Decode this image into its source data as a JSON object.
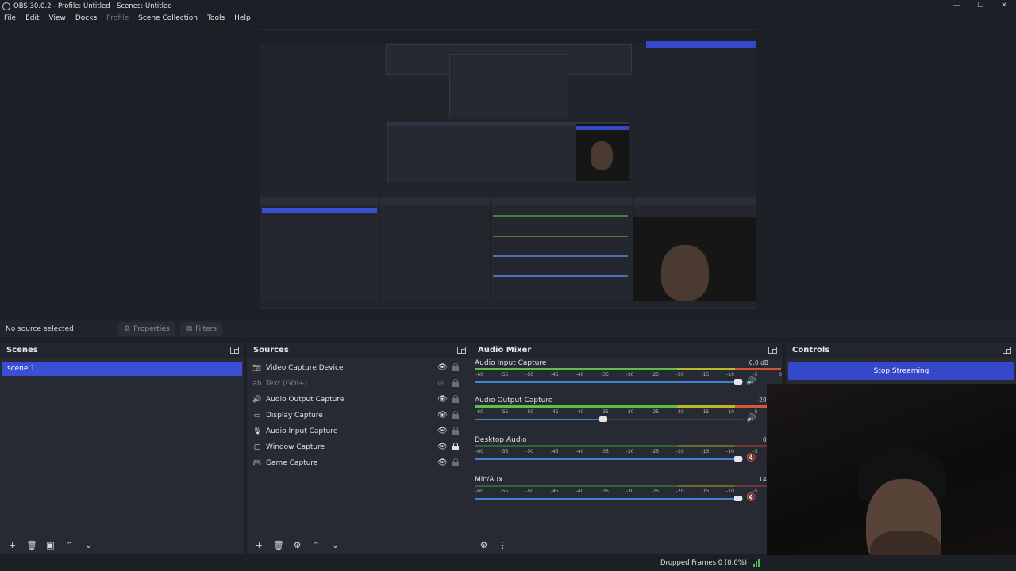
{
  "window": {
    "title": "OBS 30.0.2 - Profile: Untitled - Scenes: Untitled",
    "controls": [
      "minimize-icon",
      "maximize-icon",
      "close-icon"
    ]
  },
  "menu": {
    "file": "File",
    "edit": "Edit",
    "view": "View",
    "docks": "Docks",
    "profile": "Profile",
    "scene_collection": "Scene Collection",
    "tools": "Tools",
    "help": "Help"
  },
  "context_bar": {
    "no_source": "No source selected",
    "properties": "Properties",
    "filters": "Filters"
  },
  "scenes": {
    "title": "Scenes",
    "items": [
      "scene 1"
    ],
    "selected": "scene 1",
    "toolbar": [
      "add-icon",
      "remove-icon",
      "filter-icon",
      "move-up-icon",
      "move-down-icon"
    ]
  },
  "sources": {
    "title": "Sources",
    "items": [
      {
        "label": "Video Capture Device",
        "icon": "camera-icon",
        "visible": true,
        "locked": false
      },
      {
        "label": "Text (GDI+)",
        "icon": "text-icon",
        "visible": false,
        "locked": false
      },
      {
        "label": "Audio Output Capture",
        "icon": "speaker-icon",
        "visible": true,
        "locked": false
      },
      {
        "label": "Display Capture",
        "icon": "monitor-icon",
        "visible": true,
        "locked": false
      },
      {
        "label": "Audio Input Capture",
        "icon": "microphone-icon",
        "visible": true,
        "locked": false
      },
      {
        "label": "Window Capture",
        "icon": "window-icon",
        "visible": true,
        "locked": true
      },
      {
        "label": "Game Capture",
        "icon": "gamepad-icon",
        "visible": true,
        "locked": false
      }
    ],
    "toolbar": [
      "add-icon",
      "remove-icon",
      "gear-icon",
      "move-up-icon",
      "move-down-icon"
    ]
  },
  "audio_mixer": {
    "title": "Audio Mixer",
    "scale_ticks": [
      "-60",
      "-55",
      "-50",
      "-45",
      "-40",
      "-35",
      "-30",
      "-25",
      "-20",
      "-15",
      "-10",
      "-5",
      "0"
    ],
    "channels": [
      {
        "name": "Audio Input Capture",
        "db": "0.0 dB",
        "volume_pct": 100,
        "muted": false
      },
      {
        "name": "Audio Output Capture",
        "db": "-20.",
        "volume_pct": 48,
        "muted": false
      },
      {
        "name": "Desktop Audio",
        "db": "0.",
        "volume_pct": 100,
        "muted": true
      },
      {
        "name": "Mic/Aux",
        "db": "14.",
        "volume_pct": 100,
        "muted": true
      }
    ],
    "toolbar": [
      "advanced-audio-icon",
      "more-icon"
    ]
  },
  "controls": {
    "title": "Controls",
    "stop_streaming": "Stop Streaming"
  },
  "status": {
    "dropped_frames": "Dropped Frames 0 (0.0%)"
  },
  "colors": {
    "accent": "#3548c9",
    "selection": "#3a4fd6",
    "background": "#1d1f26",
    "dock": "#272a33"
  }
}
